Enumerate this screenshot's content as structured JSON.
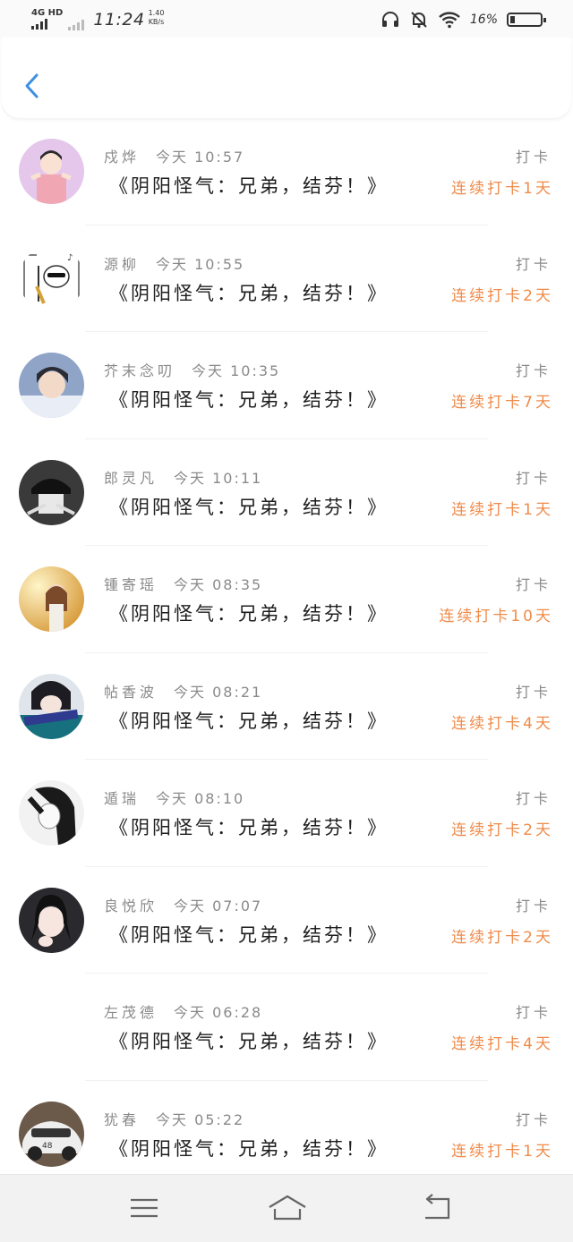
{
  "status_bar": {
    "network": "4G HD",
    "time": "11:24",
    "speed_value": "1.40",
    "speed_unit": "KB/s",
    "battery_percent": "16%",
    "battery_level": 0.16,
    "icons": [
      "headphones-icon",
      "mute-bell-icon",
      "wifi-icon",
      "battery-icon"
    ]
  },
  "header": {
    "back_icon": "chevron-left-icon",
    "accent": "#3d8fe3"
  },
  "accent_streak_color": "#ef8b4a",
  "items": [
    {
      "name": "戍烨",
      "time": "今天 10:57",
      "title": "《阴阳怪气：兄弟，结芬！》",
      "type": "打卡",
      "streak": "连续打卡1天"
    },
    {
      "name": "源柳",
      "time": "今天 10:55",
      "title": "《阴阳怪气：兄弟，结芬！》",
      "type": "打卡",
      "streak": "连续打卡2天"
    },
    {
      "name": "芥末念叨",
      "time": "今天 10:35",
      "title": "《阴阳怪气：兄弟，结芬！》",
      "type": "打卡",
      "streak": "连续打卡7天"
    },
    {
      "name": "郎灵凡",
      "time": "今天 10:11",
      "title": "《阴阳怪气：兄弟，结芬！》",
      "type": "打卡",
      "streak": "连续打卡1天"
    },
    {
      "name": "锺寄瑶",
      "time": "今天 08:35",
      "title": "《阴阳怪气：兄弟，结芬！》",
      "type": "打卡",
      "streak": "连续打卡10天"
    },
    {
      "name": "帖香波",
      "time": "今天 08:21",
      "title": "《阴阳怪气：兄弟，结芬！》",
      "type": "打卡",
      "streak": "连续打卡4天"
    },
    {
      "name": "遁瑞",
      "time": "今天 08:10",
      "title": "《阴阳怪气：兄弟，结芬！》",
      "type": "打卡",
      "streak": "连续打卡2天"
    },
    {
      "name": "良悦欣",
      "time": "今天 07:07",
      "title": "《阴阳怪气：兄弟，结芬！》",
      "type": "打卡",
      "streak": "连续打卡2天"
    },
    {
      "name": "左茂德",
      "time": "今天 06:28",
      "title": "《阴阳怪气：兄弟，结芬！》",
      "type": "打卡",
      "streak": "连续打卡4天"
    },
    {
      "name": "犹春",
      "time": "今天 05:22",
      "title": "《阴阳怪气：兄弟，结芬！》",
      "type": "打卡",
      "streak": "连续打卡1天"
    }
  ],
  "nav": {
    "icons": [
      "menu-icon",
      "home-icon",
      "back-arrow-icon"
    ]
  }
}
